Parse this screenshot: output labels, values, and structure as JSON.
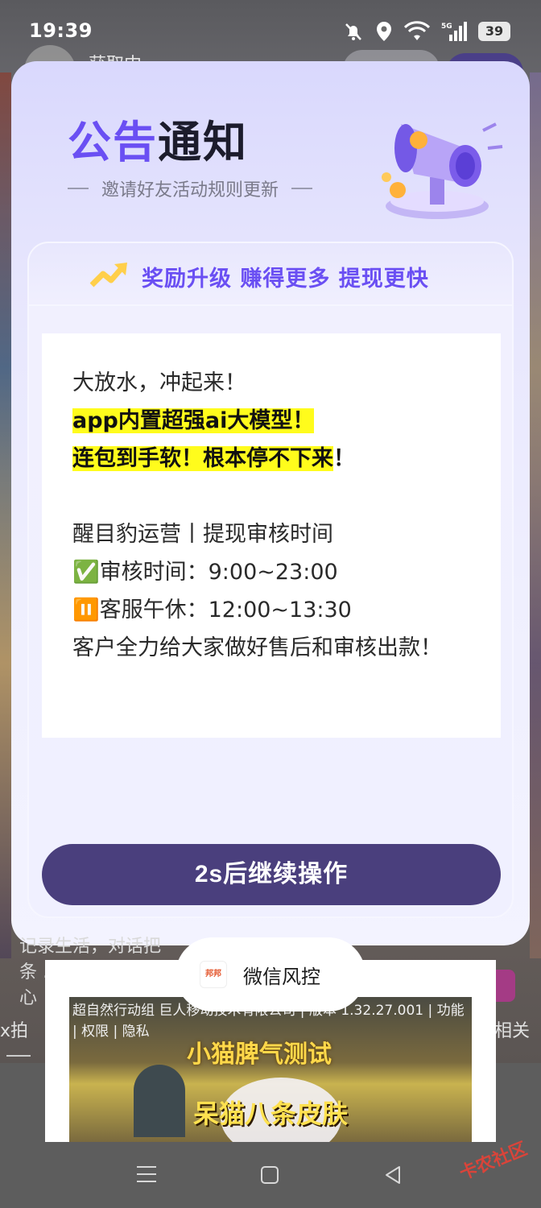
{
  "status_bar": {
    "time": "19:39",
    "battery": "39",
    "network": "5G"
  },
  "background": {
    "loading_text": "获取中",
    "text_lines": [
      "记录生活，对话把",
      "条 ……",
      "心"
    ],
    "left_fragment": "x拍",
    "right_fragment": "相关"
  },
  "popup": {
    "title_highlight": "公告",
    "title_rest": "通知",
    "subtitle": "邀请好友活动规则更新",
    "upgrade_banner": "奖励升级  赚得更多  提现更快",
    "content": {
      "line1": "大放水，冲起来！",
      "line2_highlight": "app内置超强ai大模型！",
      "line3_highlight": "连包到手软！根本停不下来",
      "line3_tail": "！",
      "line4": "醒目豹运营丨提现审核时间",
      "line5": "✅审核时间：9:00~23:00",
      "line6": "⏸️客服午休：12:00~13:30",
      "line7": "客户全力给大家做好售后和审核出款！"
    },
    "continue_button": "2s后继续操作"
  },
  "toast": {
    "logo_text": "邦邦",
    "text": "微信风控"
  },
  "ad": {
    "meta": "超自然行动组 巨人移动技术有限公司 | 版本 1.32.27.001 | 功能 | 权限 | 隐私",
    "game_title": "小猫脾气测试",
    "caption": "呆猫八条皮肤"
  },
  "watermark": "卡农社区"
}
